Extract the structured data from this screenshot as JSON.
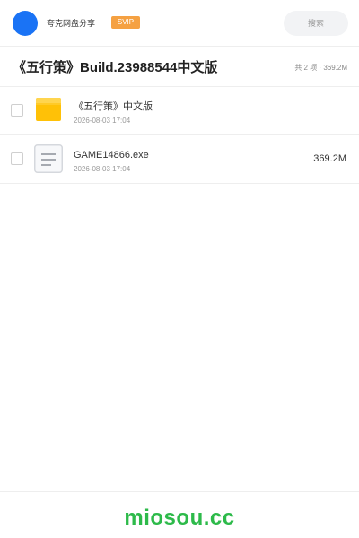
{
  "header": {
    "user_name": "夸克网盘分享",
    "badge": "SVIP",
    "search_placeholder": "搜索",
    "avatar_color": "#1a73f5",
    "badge_color": "#f5a142"
  },
  "share": {
    "title": "《五行策》Build.23988544中文版",
    "summary": "共 2 项 · 369.2M"
  },
  "files": [
    {
      "name": "《五行策》中文版",
      "date": "2026-08-03 17:04",
      "size": "",
      "icon": "folder-icon"
    },
    {
      "name": "GAME14866.exe",
      "date": "2026-08-03 17:04",
      "size": "369.2M",
      "icon": "file-document-icon"
    }
  ],
  "footer": {
    "brand": "miosou.cc",
    "brand_color": "#2dba4a"
  }
}
